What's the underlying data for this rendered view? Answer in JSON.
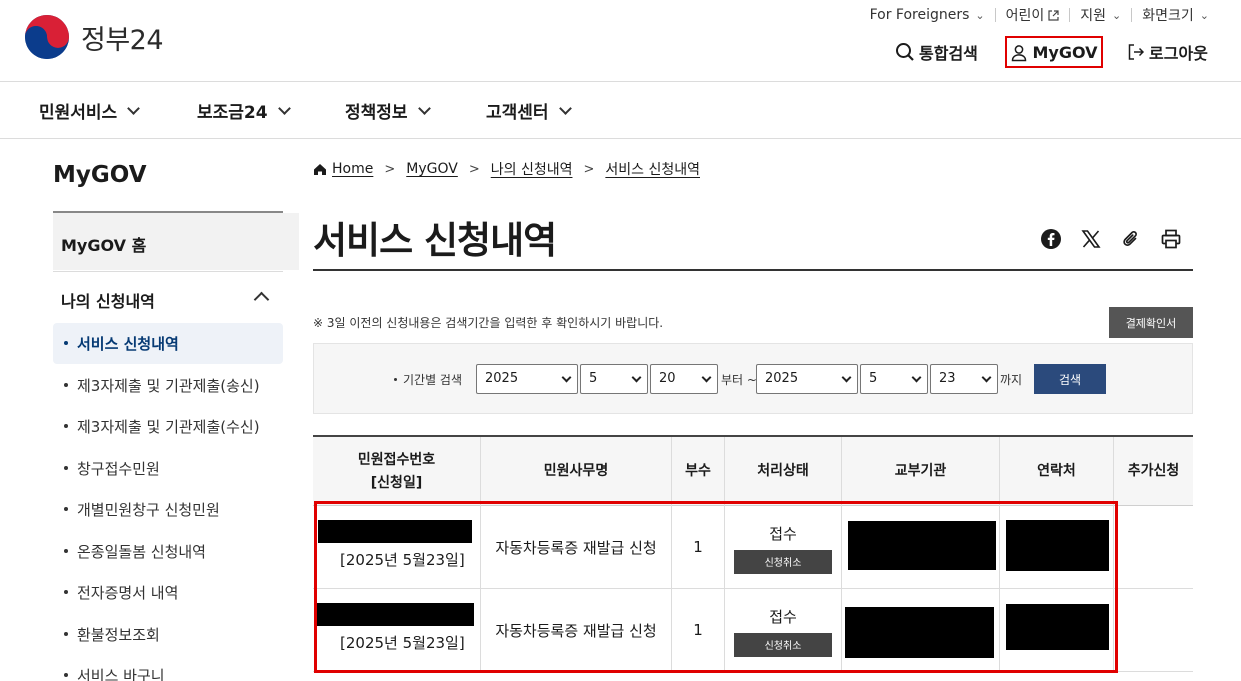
{
  "header": {
    "logo_text": "정부24",
    "util": [
      {
        "label": "For Foreigners"
      },
      {
        "label": "어린이"
      },
      {
        "label": "지원"
      },
      {
        "label": "화면크기"
      }
    ],
    "actions": {
      "search": "통합검색",
      "mygov": "MyGOV",
      "logout": "로그아웃"
    }
  },
  "gnb": [
    "민원서비스",
    "보조금24",
    "정책정보",
    "고객센터"
  ],
  "sidebar": {
    "title": "MyGOV",
    "home": "MyGOV 홈",
    "group": "나의 신청내역",
    "items": [
      "서비스 신청내역",
      "제3자제출 및 기관제출(송신)",
      "제3자제출 및 기관제출(수신)",
      "창구접수민원",
      "개별민원창구 신청민원",
      "온종일돌봄 신청내역",
      "전자증명서 내역",
      "환불정보조회",
      "서비스 바구니"
    ]
  },
  "breadcrumb": [
    "Home",
    "MyGOV",
    "나의 신청내역",
    "서비스 신청내역"
  ],
  "page_title": "서비스 신청내역",
  "notice": "※ 3일 이전의 신청내용은 검색기간을 입력한 후 확인하시기 바랍니다.",
  "receipt_button": "결제확인서",
  "search": {
    "label": "기간별 검색",
    "from": {
      "year": "2025",
      "month": "5",
      "day": "20"
    },
    "from_word": "부터 ~",
    "to": {
      "year": "2025",
      "month": "5",
      "day": "23"
    },
    "to_word": "까지",
    "button": "검색"
  },
  "table": {
    "headers": {
      "receipt_no": "민원접수번호",
      "receipt_date": "[신청일]",
      "service": "민원사무명",
      "copies": "부수",
      "status": "처리상태",
      "agency": "교부기관",
      "contact": "연락처",
      "extra": "추가신청"
    },
    "rows": [
      {
        "date": "[2025년 5월23일]",
        "service": "자동차등록증 재발급 신청",
        "copies": "1",
        "status": "접수",
        "cancel": "신청취소"
      },
      {
        "date": "[2025년 5월23일]",
        "service": "자동차등록증 재발급 신청",
        "copies": "1",
        "status": "접수",
        "cancel": "신청취소"
      }
    ]
  }
}
